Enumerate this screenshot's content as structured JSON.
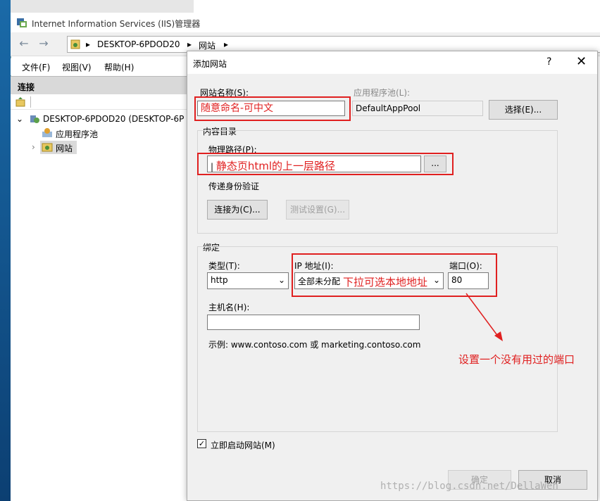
{
  "app_title": "Internet Information Services (IIS)管理器",
  "address": {
    "segments": [
      "DESKTOP-6PDOD20",
      "网站"
    ]
  },
  "menu": [
    "文件(F)",
    "视图(V)",
    "帮助(H)"
  ],
  "connections": {
    "header": "连接",
    "tree": [
      {
        "label": "DESKTOP-6PDOD20 (DESKTOP-6P",
        "level": 0
      },
      {
        "label": "应用程序池",
        "level": 1
      },
      {
        "label": "网站",
        "level": 1
      }
    ]
  },
  "dialog": {
    "title": "添加网站",
    "help": "?",
    "close": "✕",
    "site_name_label": "网站名称(S):",
    "site_name_value": "随意命名-可中文",
    "app_pool_label": "应用程序池(L):",
    "app_pool_value": "DefaultAppPool",
    "select_button": "选择(E)...",
    "content_dir_legend": "内容目录",
    "physical_path_label": "物理路径(P):",
    "physical_path_value": "静态页html的上一层路径",
    "browse_button": "...",
    "pass_auth_label": "传递身份验证",
    "connect_as_button": "连接为(C)...",
    "test_settings_button": "测试设置(G)...",
    "binding_legend": "绑定",
    "type_label": "类型(T):",
    "type_value": "http",
    "ip_label": "IP 地址(I):",
    "ip_value": "全部未分配",
    "ip_note": "下拉可选本地地址",
    "port_label": "端口(O):",
    "port_value": "80",
    "hostname_label": "主机名(H):",
    "hostname_value": "",
    "example_text": "示例: www.contoso.com 或 marketing.contoso.com",
    "port_note": "设置一个没有用过的端口",
    "start_checkbox_label": "立即启动网站(M)",
    "start_checked": true,
    "ok_button": "确定",
    "cancel_button": "取消"
  },
  "watermark": "https://blog.csdn.net/DellaWen",
  "colors": {
    "annotation": "#e02020"
  }
}
